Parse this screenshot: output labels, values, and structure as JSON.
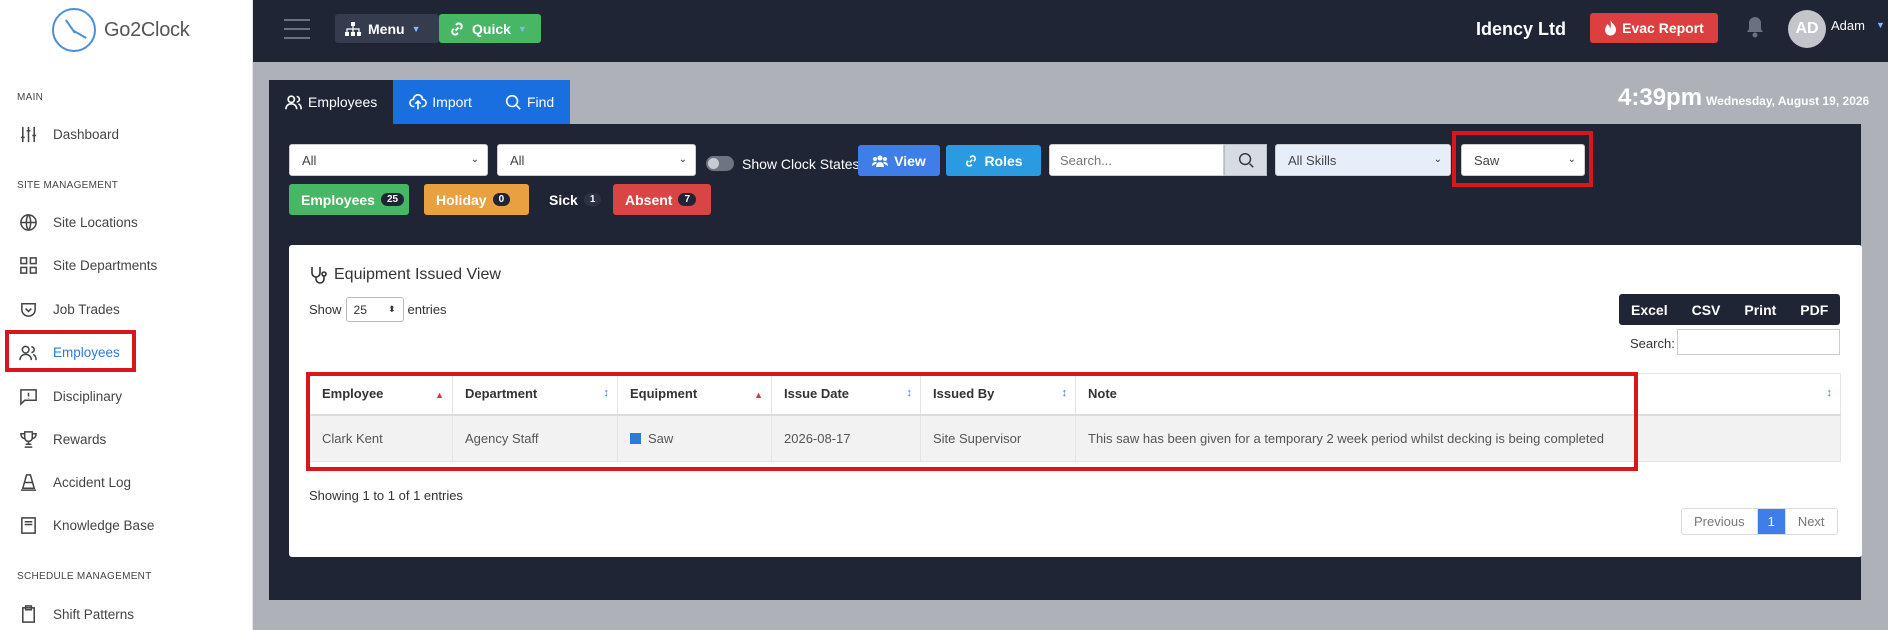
{
  "brand": {
    "name": "Go2Clock"
  },
  "sidebar": {
    "sections": [
      "MAIN",
      "SITE MANAGEMENT",
      "SCHEDULE MANAGEMENT"
    ],
    "items": [
      {
        "label": "Dashboard",
        "icon": "sliders-icon"
      },
      {
        "label": "Site Locations",
        "icon": "globe-icon"
      },
      {
        "label": "Site Departments",
        "icon": "grid-icon"
      },
      {
        "label": "Job Trades",
        "icon": "shield-icon"
      },
      {
        "label": "Employees",
        "icon": "users-icon",
        "active": true
      },
      {
        "label": "Disciplinary",
        "icon": "message-alert-icon"
      },
      {
        "label": "Rewards",
        "icon": "trophy-icon"
      },
      {
        "label": "Accident Log",
        "icon": "cone-icon"
      },
      {
        "label": "Knowledge Base",
        "icon": "book-icon"
      },
      {
        "label": "Shift Patterns",
        "icon": "clipboard-icon"
      }
    ]
  },
  "topbar": {
    "menu_label": "Menu",
    "quick_label": "Quick",
    "company": "Idency Ltd",
    "evac_label": "Evac Report",
    "user_initials": "AD",
    "user_name": "Adam"
  },
  "tabs": [
    {
      "label": "Employees",
      "active": true
    },
    {
      "label": "Import"
    },
    {
      "label": "Find"
    }
  ],
  "clock": {
    "time": "4:39pm",
    "date": "Wednesday, August 19, 2026"
  },
  "filters": {
    "select1": "All",
    "select2": "All",
    "toggle_label": "Show Clock States",
    "view_label": "View",
    "roles_label": "Roles",
    "search_placeholder": "Search...",
    "skills": "All Skills",
    "equipment": "Saw"
  },
  "counts": [
    {
      "label": "Employees",
      "count": "25"
    },
    {
      "label": "Holiday",
      "count": "0"
    },
    {
      "label": "Sick",
      "count": "1"
    },
    {
      "label": "Absent",
      "count": "7"
    }
  ],
  "card": {
    "title": "Equipment Issued View",
    "show_label": "Show",
    "entries_value": "25",
    "entries_label": "entries",
    "export": [
      "Excel",
      "CSV",
      "Print",
      "PDF"
    ],
    "search_label": "Search:",
    "columns": [
      "Employee",
      "Department",
      "Equipment",
      "Issue Date",
      "Issued By",
      "Note"
    ],
    "rows": [
      {
        "employee": "Clark Kent",
        "department": "Agency Staff",
        "equipment": "Saw",
        "issue_date": "2026-08-17",
        "issued_by": "Site Supervisor",
        "note": "This saw has been given for a temporary 2 week period whilst decking is being completed"
      }
    ],
    "showing": "Showing 1 to 1 of 1 entries",
    "pager": {
      "previous": "Previous",
      "current": "1",
      "next": "Next"
    }
  },
  "colors": {
    "dark": "#1f2535",
    "blue": "#1a6fe0",
    "green": "#47b765",
    "orange": "#e8a040",
    "red": "#d94444",
    "highlight": "#d8161b"
  }
}
